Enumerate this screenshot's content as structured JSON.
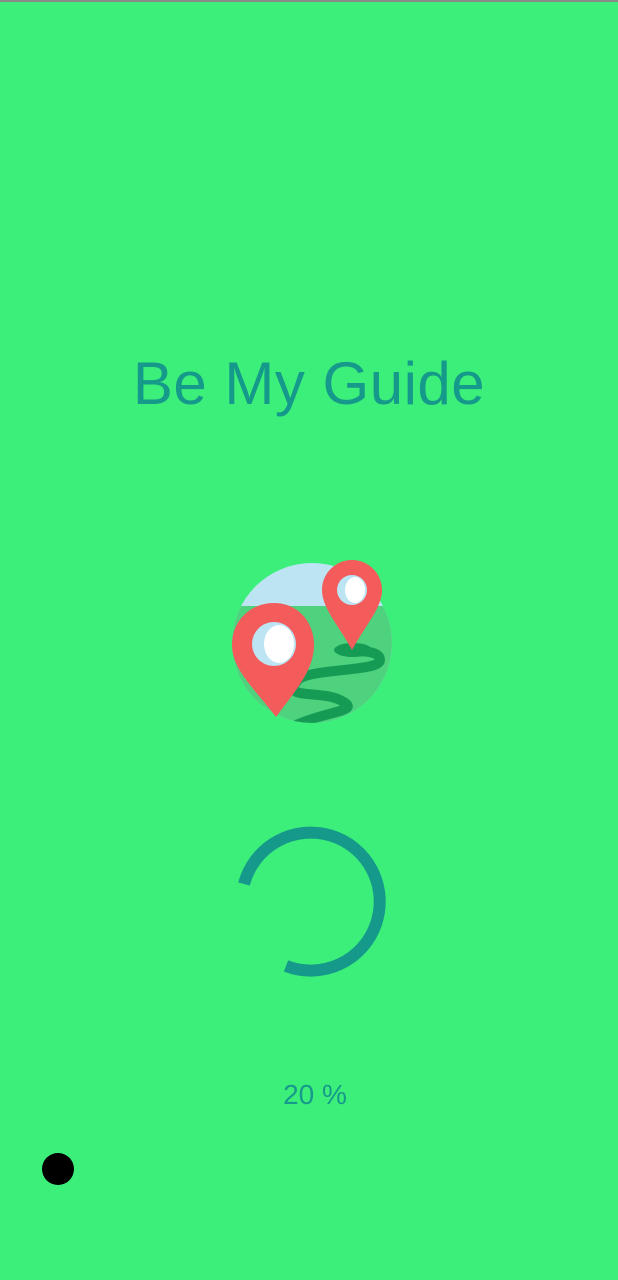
{
  "app": {
    "title": "Be My Guide",
    "logo_icon": "map-pin-globe-icon"
  },
  "loading": {
    "progress_text": "20 %",
    "progress_percent": 20,
    "spinner_icon": "loading-spinner-icon"
  },
  "colors": {
    "background": "#3CEF7B",
    "accent": "#15998A",
    "pin": "#F45B5B",
    "sky": "#BCE4F3",
    "ground": "#4FD27E",
    "road": "#169B55"
  }
}
